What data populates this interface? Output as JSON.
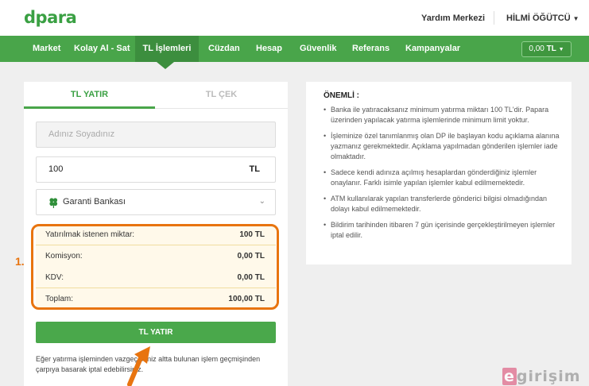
{
  "header": {
    "logo": "dpara",
    "help_link": "Yardım Merkezi",
    "user_name": "HİLMİ ÖĞÜTCÜ"
  },
  "nav": {
    "items": [
      {
        "label": "Market",
        "active": false
      },
      {
        "label": "Kolay Al - Sat",
        "active": false
      },
      {
        "label": "TL İşlemleri",
        "active": true
      },
      {
        "label": "Cüzdan",
        "active": false
      },
      {
        "label": "Hesap",
        "active": false
      },
      {
        "label": "Güvenlik",
        "active": false
      },
      {
        "label": "Referans",
        "active": false
      },
      {
        "label": "Kampanyalar",
        "active": false
      }
    ],
    "balance_amount": "0,00",
    "balance_currency": "TL"
  },
  "tabs": {
    "deposit": "TL YATIR",
    "withdraw": "TL ÇEK"
  },
  "form": {
    "name_placeholder": "Adınız Soyadınız",
    "amount_value": "100",
    "amount_unit": "TL",
    "bank_name": "Garanti Bankası",
    "bank_icon": "clover-icon"
  },
  "summary": {
    "rows": [
      {
        "label": "Yatırılmak istenen miktar:",
        "value": "100 TL"
      },
      {
        "label": "Komisyon:",
        "value": "0,00 TL"
      },
      {
        "label": "KDV:",
        "value": "0,00 TL"
      },
      {
        "label": "Toplam:",
        "value": "100,00 TL"
      }
    ]
  },
  "submit_label": "TL YATIR",
  "footnote": "Eğer yatırma işleminden vazgeç seniz altta bulunan işlem geçmişinden çarpıya basarak iptal edebilirsiniz.",
  "annotation": {
    "step": "1."
  },
  "notice": {
    "title": "ÖNEMLİ :",
    "items": [
      "Banka ile yatıracaksanız minimum yatırma miktarı 100 TL'dir. Papara üzerinden yapılacak yatırma işlemlerinde minimum limit yoktur.",
      "İşleminize özel tanımlanmış olan DP ile başlayan kodu açıklama alanına yazmanız gerekmektedir. Açıklama yapılmadan gönderilen işlemler iade olmaktadır.",
      "Sadece kendi adınıza açılmış hesaplardan gönderdiğiniz işlemler onaylanır. Farklı isimle yapılan işlemler kabul edilmemektedir.",
      "ATM kullanılarak yapılan transferlerde gönderici bilgisi olmadığından dolayı kabul edilmemektedir.",
      "Bildirim tarihinden itibaren 7 gün içerisinde gerçekleştirilmeyen işlemler iptal edilir."
    ]
  },
  "watermark": {
    "first_letter": "e",
    "rest": "girişim"
  },
  "colors": {
    "brand_green": "#49a54a",
    "annotation_orange": "#e8740f"
  }
}
